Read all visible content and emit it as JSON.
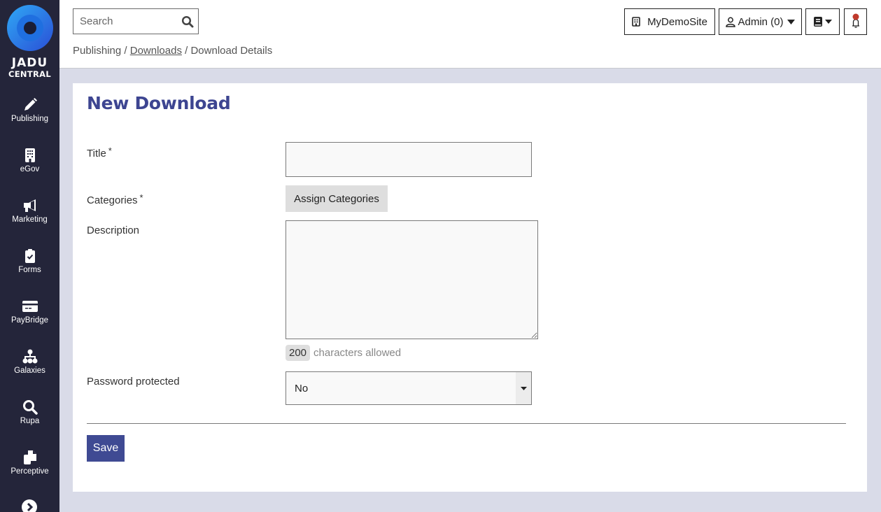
{
  "brand": {
    "line1": "JADU",
    "line2": "CENTRAL"
  },
  "sidebar": {
    "items": [
      {
        "label": "Publishing",
        "icon": "pencil-icon"
      },
      {
        "label": "eGov",
        "icon": "building-icon"
      },
      {
        "label": "Marketing",
        "icon": "megaphone-icon"
      },
      {
        "label": "Forms",
        "icon": "clipboard-check-icon"
      },
      {
        "label": "PayBridge",
        "icon": "credit-card-icon"
      },
      {
        "label": "Galaxies",
        "icon": "sitemap-icon"
      },
      {
        "label": "Rupa",
        "icon": "search-icon"
      },
      {
        "label": "Perceptive",
        "icon": "copy-icon"
      }
    ],
    "more_icon": "chevron-right-circle-icon"
  },
  "header": {
    "search": {
      "placeholder": "Search",
      "value": ""
    },
    "breadcrumb": {
      "item1": "Publishing",
      "sep": "/",
      "item2": "Downloads",
      "item3": "Download Details"
    },
    "site_button": "MyDemoSite",
    "user_button": "Admin (0)",
    "notification_dot_color": "#c0392b"
  },
  "main": {
    "title": "New Download",
    "title_color": "#3d4591",
    "fields": {
      "title_label": "Title",
      "title_value": "",
      "categories_label": "Categories",
      "assign_button": "Assign Categories",
      "description_label": "Description",
      "description_value": "",
      "char_count": "200",
      "char_text": "characters allowed",
      "password_label": "Password protected",
      "password_value": "No",
      "required_mark": "*"
    },
    "save_button": "Save",
    "accent_color": "#3f4a93"
  }
}
